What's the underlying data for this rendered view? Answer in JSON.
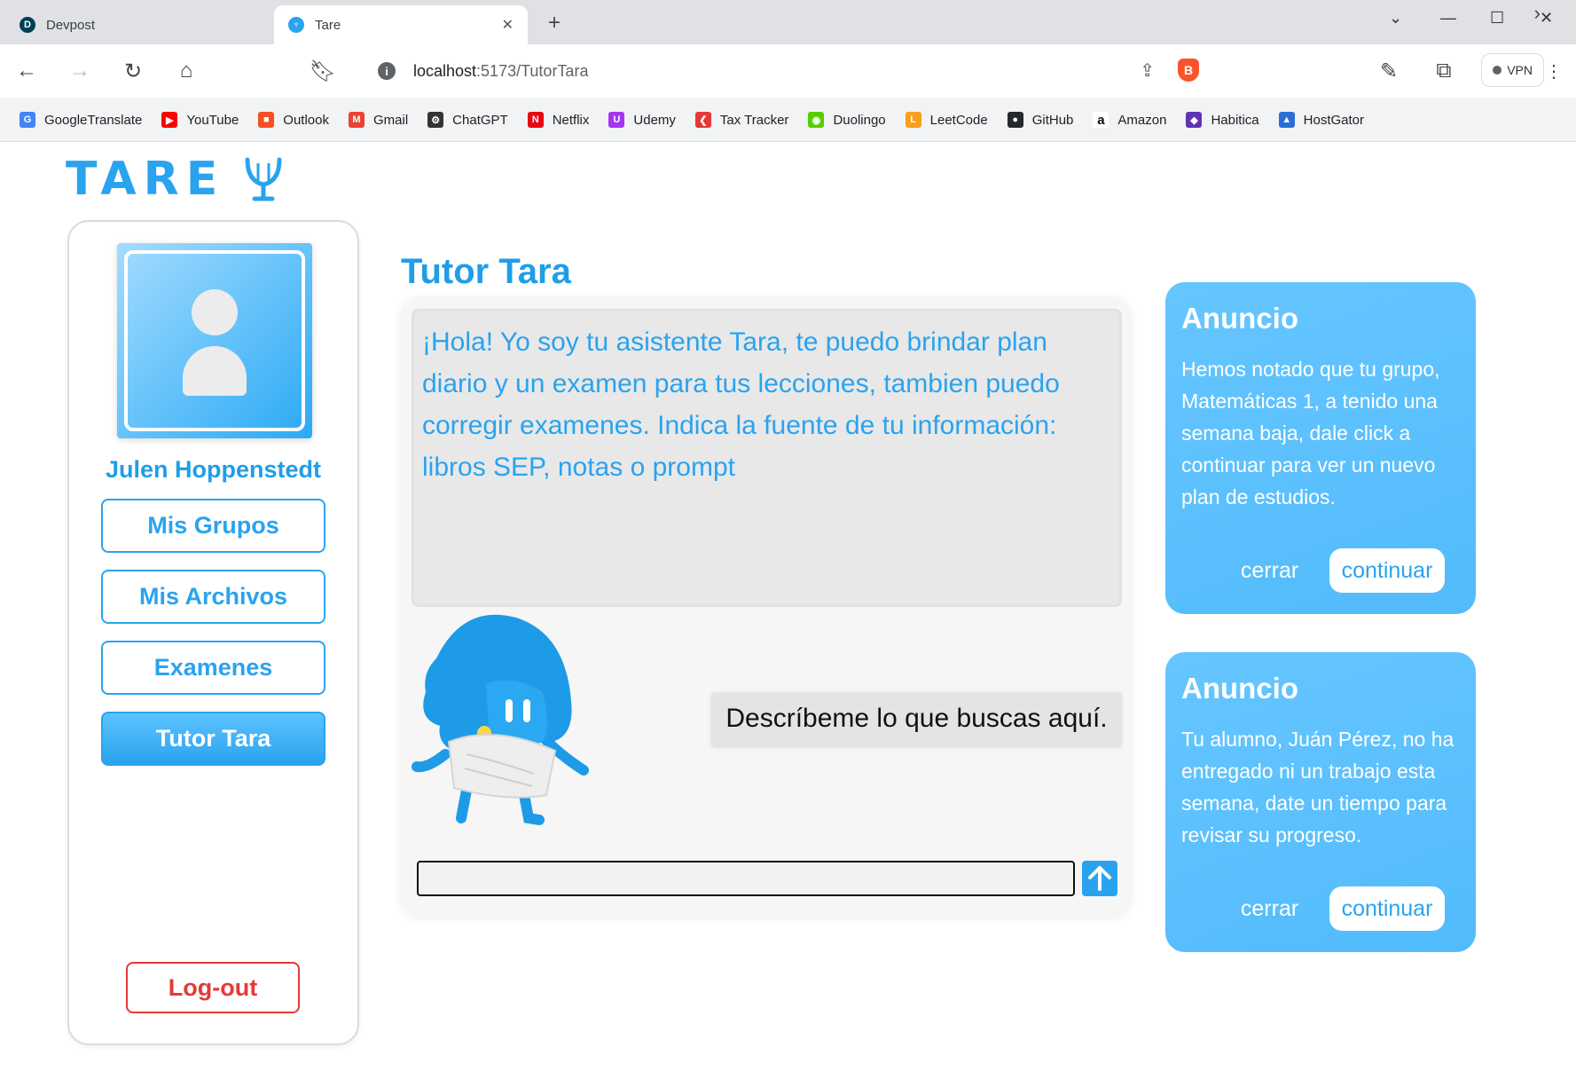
{
  "browser": {
    "tabs": [
      {
        "title": "Devpost",
        "favicon": "D",
        "active": false
      },
      {
        "title": "Tare",
        "active": true
      }
    ],
    "url_host": "localhost",
    "url_path": ":5173/TutorTara",
    "vpn_label": "VPN",
    "bookmarks": [
      {
        "label": "GoogleTranslate",
        "icon": "google-translate-icon",
        "color": "#4285f4",
        "glyph": "G"
      },
      {
        "label": "YouTube",
        "icon": "youtube-icon",
        "color": "#ff0000",
        "glyph": "▶"
      },
      {
        "label": "Outlook",
        "icon": "windows-icon",
        "color": "#f25022",
        "glyph": "■"
      },
      {
        "label": "Gmail",
        "icon": "gmail-icon",
        "color": "#ea4335",
        "glyph": "M"
      },
      {
        "label": "ChatGPT",
        "icon": "chatgpt-icon",
        "color": "#333333",
        "glyph": "⚙"
      },
      {
        "label": "Netflix",
        "icon": "netflix-icon",
        "color": "#e50914",
        "glyph": "N"
      },
      {
        "label": "Udemy",
        "icon": "udemy-icon",
        "color": "#a435f0",
        "glyph": "U"
      },
      {
        "label": "Tax Tracker",
        "icon": "tax-tracker-icon",
        "color": "#e53935",
        "glyph": "❮"
      },
      {
        "label": "Duolingo",
        "icon": "duolingo-icon",
        "color": "#58cc02",
        "glyph": "◉"
      },
      {
        "label": "LeetCode",
        "icon": "leetcode-icon",
        "color": "#f89f1b",
        "glyph": "L"
      },
      {
        "label": "GitHub",
        "icon": "github-icon",
        "color": "#24292e",
        "glyph": "●"
      },
      {
        "label": "Amazon",
        "icon": "amazon-icon",
        "color": "#ffffff",
        "glyph": "a"
      },
      {
        "label": "Habitica",
        "icon": "habitica-icon",
        "color": "#6133b4",
        "glyph": "◆"
      },
      {
        "label": "HostGator",
        "icon": "hostgator-icon",
        "color": "#2b6fd6",
        "glyph": "▲"
      }
    ]
  },
  "app": {
    "logo_text": "TARE",
    "user_name": "Julen Hoppenstedt",
    "nav": [
      {
        "label": "Mis Grupos",
        "active": false
      },
      {
        "label": "Mis Archivos",
        "active": false
      },
      {
        "label": "Examenes",
        "active": false
      },
      {
        "label": "Tutor Tara",
        "active": true
      }
    ],
    "logout_label": "Log-out",
    "page_title": "Tutor Tara",
    "chat": {
      "assistant_message": "¡Hola! Yo soy tu asistente Tara, te puedo brindar plan diario y un examen para tus lecciones, tambien puedo corregir examenes. Indica la fuente de tu información: libros SEP, notas o prompt",
      "hint": "Descríbeme lo que buscas aquí.",
      "input_value": "",
      "input_placeholder": ""
    },
    "announcements": [
      {
        "title": "Anuncio",
        "body": "Hemos notado que tu grupo, Matemáticas 1, a tenido una semana baja, dale click a continuar para ver un nuevo plan de estudios.",
        "close_label": "cerrar",
        "continue_label": "continuar"
      },
      {
        "title": "Anuncio",
        "body": "Tu alumno, Juán Pérez, no ha entregado ni un trabajo esta semana, date un tiempo para revisar su progreso.",
        "close_label": "cerrar",
        "continue_label": "continuar"
      }
    ],
    "colors": {
      "accent": "#2aa3ef",
      "card": "#5bc0fd",
      "logout": "#e53935"
    }
  }
}
